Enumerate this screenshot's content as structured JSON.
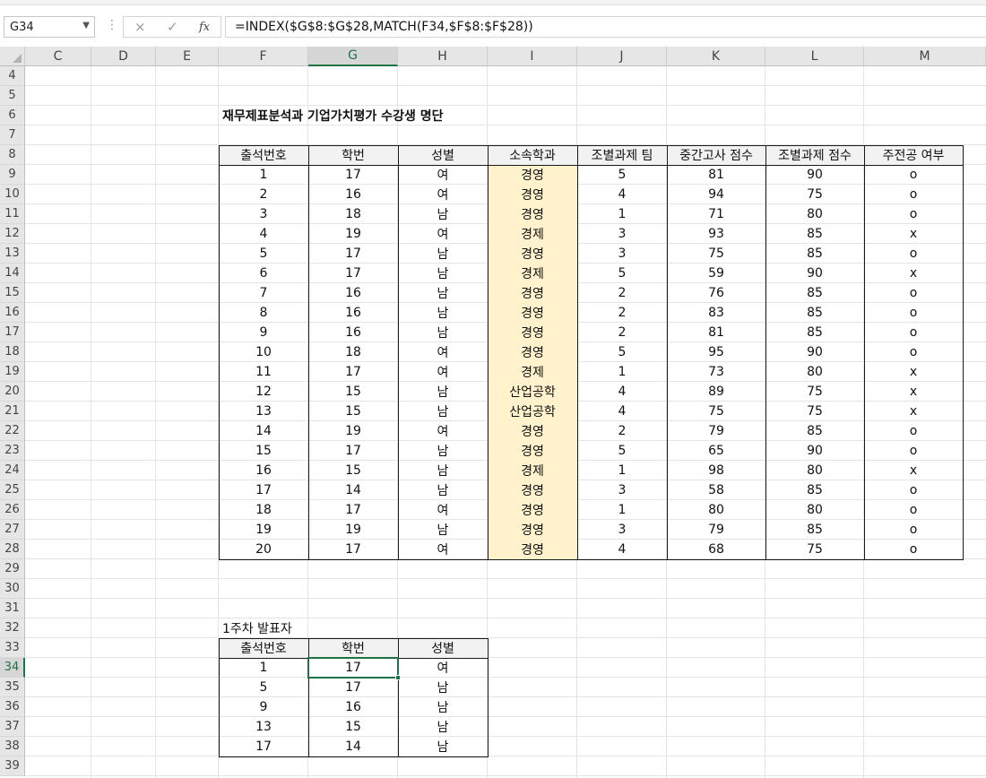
{
  "name_box": "G34",
  "formula_bar": {
    "cancel_icon": "×",
    "enter_icon": "✓",
    "fx_label": "fx",
    "formula": "=INDEX($G$8:$G$28,MATCH(F34,$F$8:$F$28))"
  },
  "columns": [
    "C",
    "D",
    "E",
    "F",
    "G",
    "H",
    "I",
    "J",
    "K",
    "L",
    "M"
  ],
  "rows": [
    "4",
    "5",
    "6",
    "7",
    "8",
    "9",
    "10",
    "11",
    "12",
    "13",
    "14",
    "15",
    "16",
    "17",
    "18",
    "19",
    "20",
    "21",
    "22",
    "23",
    "24",
    "25",
    "26",
    "27",
    "28",
    "29",
    "30",
    "31",
    "32",
    "33",
    "34",
    "35",
    "36",
    "37",
    "38",
    "39"
  ],
  "active_cell": {
    "column": "G",
    "row": "34"
  },
  "main_table": {
    "title": "재무제표분석과 기업가치평가 수강생 명단",
    "headers": [
      "출석번호",
      "학번",
      "성별",
      "소속학과",
      "조별과제 팀",
      "중간고사 점수",
      "조별과제 점수",
      "주전공 여부"
    ],
    "rows": [
      [
        "1",
        "17",
        "여",
        "경영",
        "5",
        "81",
        "90",
        "o"
      ],
      [
        "2",
        "16",
        "여",
        "경영",
        "4",
        "94",
        "75",
        "o"
      ],
      [
        "3",
        "18",
        "남",
        "경영",
        "1",
        "71",
        "80",
        "o"
      ],
      [
        "4",
        "19",
        "여",
        "경제",
        "3",
        "93",
        "85",
        "x"
      ],
      [
        "5",
        "17",
        "남",
        "경영",
        "3",
        "75",
        "85",
        "o"
      ],
      [
        "6",
        "17",
        "남",
        "경제",
        "5",
        "59",
        "90",
        "x"
      ],
      [
        "7",
        "16",
        "남",
        "경영",
        "2",
        "76",
        "85",
        "o"
      ],
      [
        "8",
        "16",
        "남",
        "경영",
        "2",
        "83",
        "85",
        "o"
      ],
      [
        "9",
        "16",
        "남",
        "경영",
        "2",
        "81",
        "85",
        "o"
      ],
      [
        "10",
        "18",
        "여",
        "경영",
        "5",
        "95",
        "90",
        "o"
      ],
      [
        "11",
        "17",
        "여",
        "경제",
        "1",
        "73",
        "80",
        "x"
      ],
      [
        "12",
        "15",
        "남",
        "산업공학",
        "4",
        "89",
        "75",
        "x"
      ],
      [
        "13",
        "15",
        "남",
        "산업공학",
        "4",
        "75",
        "75",
        "x"
      ],
      [
        "14",
        "19",
        "여",
        "경영",
        "2",
        "79",
        "85",
        "o"
      ],
      [
        "15",
        "17",
        "남",
        "경영",
        "5",
        "65",
        "90",
        "o"
      ],
      [
        "16",
        "15",
        "남",
        "경제",
        "1",
        "98",
        "80",
        "x"
      ],
      [
        "17",
        "14",
        "남",
        "경영",
        "3",
        "58",
        "85",
        "o"
      ],
      [
        "18",
        "17",
        "여",
        "경영",
        "1",
        "80",
        "80",
        "o"
      ],
      [
        "19",
        "19",
        "남",
        "경영",
        "3",
        "79",
        "85",
        "o"
      ],
      [
        "20",
        "17",
        "여",
        "경영",
        "4",
        "68",
        "75",
        "o"
      ]
    ]
  },
  "presenter_table": {
    "title": "1주차 발표자",
    "headers": [
      "출석번호",
      "학번",
      "성별"
    ],
    "rows": [
      [
        "1",
        "17",
        "여"
      ],
      [
        "5",
        "17",
        "남"
      ],
      [
        "9",
        "16",
        "남"
      ],
      [
        "13",
        "15",
        "남"
      ],
      [
        "17",
        "14",
        "남"
      ]
    ]
  },
  "colors": {
    "accent": "#217346",
    "highlight_fill": "#fff2cc",
    "header_fill": "#f2f2f2"
  }
}
